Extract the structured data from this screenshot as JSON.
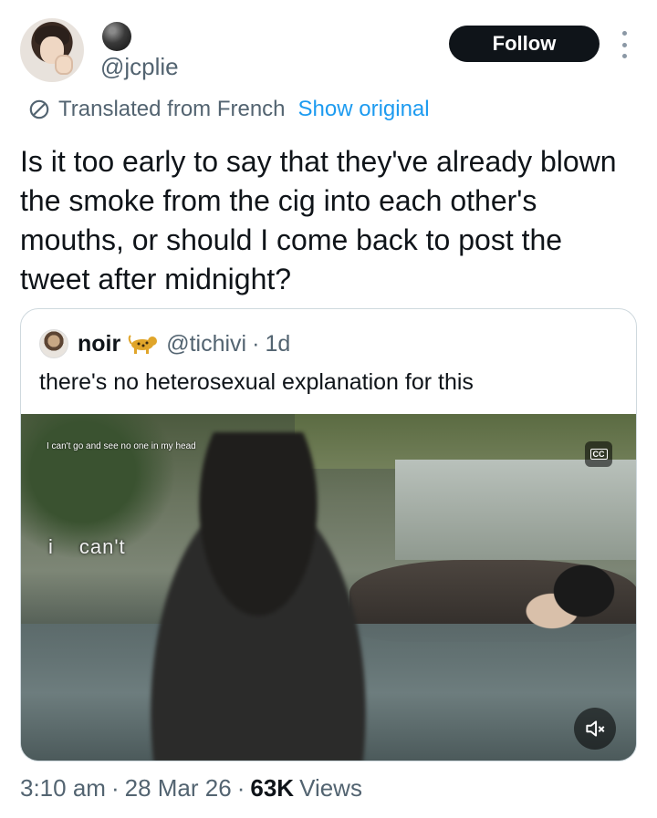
{
  "author": {
    "handle": "@jcplie",
    "follow_label": "Follow"
  },
  "translation": {
    "note": "Translated from French",
    "show_original": "Show original"
  },
  "tweet": {
    "text": "Is it too early to say that they've already blown the smoke from the cig into each other's mouths, or should I come back to post the tweet after midnight?"
  },
  "quote": {
    "name": "noir",
    "handle": "@tichivi",
    "separator": "·",
    "age": "1d",
    "text": "there's no heterosexual explanation for this",
    "video": {
      "subtitle_small": "I can't go and see no one in my head",
      "subtitle_word1": "i",
      "subtitle_word2": "can't",
      "cc_label": "CC"
    }
  },
  "meta": {
    "time": "3:10 am",
    "sep1": "·",
    "date": "28 Mar 26",
    "sep2": "·",
    "views_count": "63K",
    "views_label": "Views"
  },
  "icons": [
    "translate-icon",
    "more-icon",
    "leopard-emoji-icon",
    "cc-icon",
    "mute-icon"
  ]
}
